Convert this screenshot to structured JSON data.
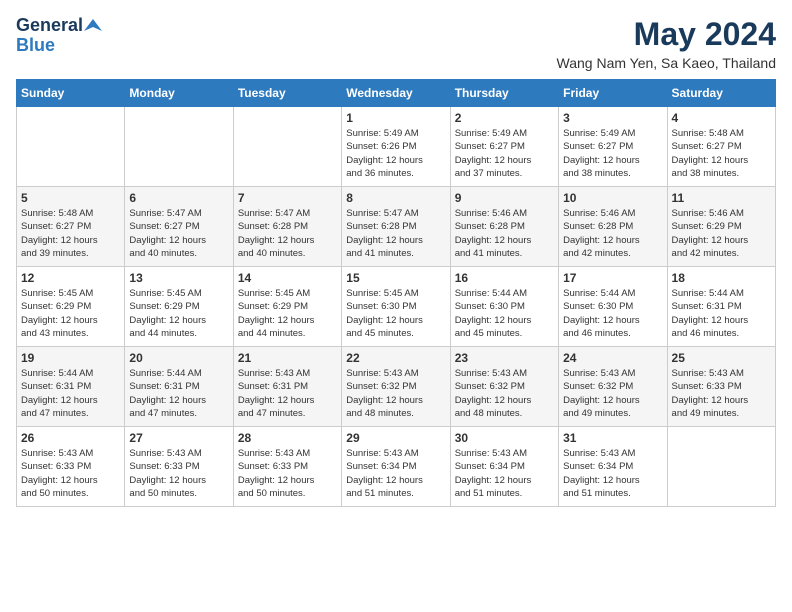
{
  "header": {
    "logo_general": "General",
    "logo_blue": "Blue",
    "month_year": "May 2024",
    "location": "Wang Nam Yen, Sa Kaeo, Thailand"
  },
  "calendar": {
    "days_of_week": [
      "Sunday",
      "Monday",
      "Tuesday",
      "Wednesday",
      "Thursday",
      "Friday",
      "Saturday"
    ],
    "weeks": [
      [
        {
          "day": "",
          "info": ""
        },
        {
          "day": "",
          "info": ""
        },
        {
          "day": "",
          "info": ""
        },
        {
          "day": "1",
          "info": "Sunrise: 5:49 AM\nSunset: 6:26 PM\nDaylight: 12 hours\nand 36 minutes."
        },
        {
          "day": "2",
          "info": "Sunrise: 5:49 AM\nSunset: 6:27 PM\nDaylight: 12 hours\nand 37 minutes."
        },
        {
          "day": "3",
          "info": "Sunrise: 5:49 AM\nSunset: 6:27 PM\nDaylight: 12 hours\nand 38 minutes."
        },
        {
          "day": "4",
          "info": "Sunrise: 5:48 AM\nSunset: 6:27 PM\nDaylight: 12 hours\nand 38 minutes."
        }
      ],
      [
        {
          "day": "5",
          "info": "Sunrise: 5:48 AM\nSunset: 6:27 PM\nDaylight: 12 hours\nand 39 minutes."
        },
        {
          "day": "6",
          "info": "Sunrise: 5:47 AM\nSunset: 6:27 PM\nDaylight: 12 hours\nand 40 minutes."
        },
        {
          "day": "7",
          "info": "Sunrise: 5:47 AM\nSunset: 6:28 PM\nDaylight: 12 hours\nand 40 minutes."
        },
        {
          "day": "8",
          "info": "Sunrise: 5:47 AM\nSunset: 6:28 PM\nDaylight: 12 hours\nand 41 minutes."
        },
        {
          "day": "9",
          "info": "Sunrise: 5:46 AM\nSunset: 6:28 PM\nDaylight: 12 hours\nand 41 minutes."
        },
        {
          "day": "10",
          "info": "Sunrise: 5:46 AM\nSunset: 6:28 PM\nDaylight: 12 hours\nand 42 minutes."
        },
        {
          "day": "11",
          "info": "Sunrise: 5:46 AM\nSunset: 6:29 PM\nDaylight: 12 hours\nand 42 minutes."
        }
      ],
      [
        {
          "day": "12",
          "info": "Sunrise: 5:45 AM\nSunset: 6:29 PM\nDaylight: 12 hours\nand 43 minutes."
        },
        {
          "day": "13",
          "info": "Sunrise: 5:45 AM\nSunset: 6:29 PM\nDaylight: 12 hours\nand 44 minutes."
        },
        {
          "day": "14",
          "info": "Sunrise: 5:45 AM\nSunset: 6:29 PM\nDaylight: 12 hours\nand 44 minutes."
        },
        {
          "day": "15",
          "info": "Sunrise: 5:45 AM\nSunset: 6:30 PM\nDaylight: 12 hours\nand 45 minutes."
        },
        {
          "day": "16",
          "info": "Sunrise: 5:44 AM\nSunset: 6:30 PM\nDaylight: 12 hours\nand 45 minutes."
        },
        {
          "day": "17",
          "info": "Sunrise: 5:44 AM\nSunset: 6:30 PM\nDaylight: 12 hours\nand 46 minutes."
        },
        {
          "day": "18",
          "info": "Sunrise: 5:44 AM\nSunset: 6:31 PM\nDaylight: 12 hours\nand 46 minutes."
        }
      ],
      [
        {
          "day": "19",
          "info": "Sunrise: 5:44 AM\nSunset: 6:31 PM\nDaylight: 12 hours\nand 47 minutes."
        },
        {
          "day": "20",
          "info": "Sunrise: 5:44 AM\nSunset: 6:31 PM\nDaylight: 12 hours\nand 47 minutes."
        },
        {
          "day": "21",
          "info": "Sunrise: 5:43 AM\nSunset: 6:31 PM\nDaylight: 12 hours\nand 47 minutes."
        },
        {
          "day": "22",
          "info": "Sunrise: 5:43 AM\nSunset: 6:32 PM\nDaylight: 12 hours\nand 48 minutes."
        },
        {
          "day": "23",
          "info": "Sunrise: 5:43 AM\nSunset: 6:32 PM\nDaylight: 12 hours\nand 48 minutes."
        },
        {
          "day": "24",
          "info": "Sunrise: 5:43 AM\nSunset: 6:32 PM\nDaylight: 12 hours\nand 49 minutes."
        },
        {
          "day": "25",
          "info": "Sunrise: 5:43 AM\nSunset: 6:33 PM\nDaylight: 12 hours\nand 49 minutes."
        }
      ],
      [
        {
          "day": "26",
          "info": "Sunrise: 5:43 AM\nSunset: 6:33 PM\nDaylight: 12 hours\nand 50 minutes."
        },
        {
          "day": "27",
          "info": "Sunrise: 5:43 AM\nSunset: 6:33 PM\nDaylight: 12 hours\nand 50 minutes."
        },
        {
          "day": "28",
          "info": "Sunrise: 5:43 AM\nSunset: 6:33 PM\nDaylight: 12 hours\nand 50 minutes."
        },
        {
          "day": "29",
          "info": "Sunrise: 5:43 AM\nSunset: 6:34 PM\nDaylight: 12 hours\nand 51 minutes."
        },
        {
          "day": "30",
          "info": "Sunrise: 5:43 AM\nSunset: 6:34 PM\nDaylight: 12 hours\nand 51 minutes."
        },
        {
          "day": "31",
          "info": "Sunrise: 5:43 AM\nSunset: 6:34 PM\nDaylight: 12 hours\nand 51 minutes."
        },
        {
          "day": "",
          "info": ""
        }
      ]
    ]
  }
}
